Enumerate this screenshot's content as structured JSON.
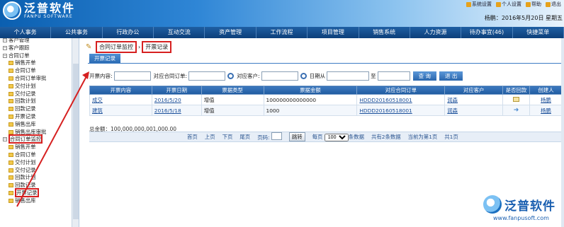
{
  "brand": {
    "name_cn": "泛普软件",
    "name_en": "FANPU SOFTWARE"
  },
  "toplinks": [
    "系统设置",
    "个人设置",
    "帮助",
    "退出"
  ],
  "userline": "杨鹏：2016年5月20日 星期五",
  "nav": [
    "个人事务",
    "公共事务",
    "行政办公",
    "互动交流",
    "资产管理",
    "工作流程",
    "项目管理",
    "销售系统",
    "人力资源",
    "待办事宜(46)",
    "快捷菜单"
  ],
  "sidebar": [
    {
      "label": "客户管理",
      "indent": 1,
      "type": "pm"
    },
    {
      "label": "客户跟踪",
      "indent": 1,
      "type": "pm"
    },
    {
      "label": "合同订单",
      "indent": 1,
      "type": "pm"
    },
    {
      "label": "销售开单",
      "indent": 3,
      "type": "f"
    },
    {
      "label": "合同订单",
      "indent": 3,
      "type": "f"
    },
    {
      "label": "合同订单审批",
      "indent": 3,
      "type": "f"
    },
    {
      "label": "交付计划",
      "indent": 3,
      "type": "f"
    },
    {
      "label": "交付记录",
      "indent": 3,
      "type": "f"
    },
    {
      "label": "回款计划",
      "indent": 3,
      "type": "f"
    },
    {
      "label": "回款记录",
      "indent": 3,
      "type": "f"
    },
    {
      "label": "开票记录",
      "indent": 3,
      "type": "f"
    },
    {
      "label": "销售出库",
      "indent": 3,
      "type": "f"
    },
    {
      "label": "销售出库审批",
      "indent": 3,
      "type": "f"
    },
    {
      "label": "合同订单监控",
      "indent": 1,
      "type": "pm"
    },
    {
      "label": "销售开单",
      "indent": 3,
      "type": "f"
    },
    {
      "label": "合同订单",
      "indent": 3,
      "type": "f"
    },
    {
      "label": "交付计划",
      "indent": 3,
      "type": "f"
    },
    {
      "label": "交付记录",
      "indent": 3,
      "type": "f"
    },
    {
      "label": "回款计划",
      "indent": 3,
      "type": "f"
    },
    {
      "label": "回款记录",
      "indent": 3,
      "type": "f"
    },
    {
      "label": "开票记录",
      "indent": 3,
      "type": "f"
    },
    {
      "label": "销售出库",
      "indent": 3,
      "type": "f"
    }
  ],
  "breadcrumb": {
    "parent": "合同订单监控",
    "current": "开票记录"
  },
  "subtab": "开票记录",
  "search": {
    "label_content": "开票内容:",
    "label_order": "对应合同订单:",
    "label_customer": "对应客户:",
    "label_date_from": "日期从",
    "label_date_to": "至",
    "btn_query": "查 询",
    "btn_exit": "退 出"
  },
  "table": {
    "headers": [
      "开票内容",
      "开票日期",
      "票据类型",
      "票据金额",
      "对应合同订单",
      "对应客户",
      "是否回款",
      "创建人"
    ],
    "rows": [
      [
        "成交",
        "2016/5/20",
        "增值",
        "100000000000000",
        "HDDD20160518001",
        "润森",
        "",
        "杨鹏"
      ],
      [
        "建筑",
        "2016/5/18",
        "增值",
        "1000",
        "HDDD20160518001",
        "润森",
        "",
        "杨鹏"
      ]
    ]
  },
  "total": "总金额：100,000,000,001,000.00",
  "pager": {
    "first": "首页",
    "prev": "上页",
    "next": "下页",
    "last": "尾页",
    "page_label": "页码:",
    "go": "跳转",
    "per_page": "每页",
    "per_page_value": "100",
    "per_page_suffix": "条数据",
    "total_records": "共有2条数据",
    "current_page": "当前为第1页",
    "total_pages": "共1页"
  },
  "watermark": {
    "cn": "泛普软件",
    "url": "www.fanpusoft.com"
  }
}
